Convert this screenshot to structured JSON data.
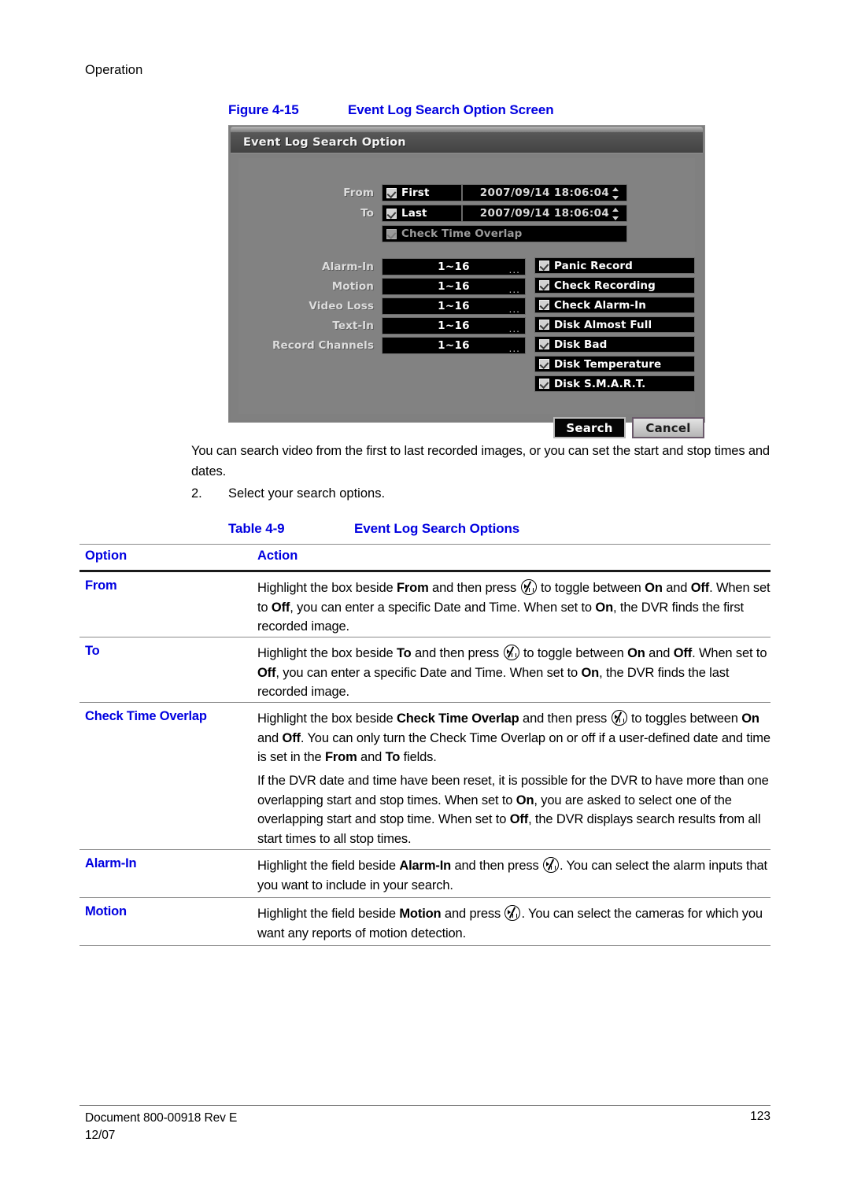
{
  "page": {
    "running_head": "Operation",
    "footer_document": "Document 800-00918 Rev E",
    "footer_date": "12/07",
    "footer_page_number": "123"
  },
  "figure": {
    "number": "Figure 4-15",
    "title": "Event Log Search Option Screen",
    "caption_color": "#0000e0"
  },
  "dvr_dialog": {
    "title": "Event Log Search Option",
    "colors": {
      "titlebar": "#4b4b4b",
      "body": "#808080",
      "field_background": "#000000",
      "field_text": "#ffffff"
    },
    "time_rows": [
      {
        "label": "From",
        "checkbox_label": "First",
        "checked": true,
        "enabled": true,
        "datetime": "2007/09/14  18:06:04",
        "spinner": true
      },
      {
        "label": "To",
        "checkbox_label": "Last",
        "checked": true,
        "enabled": true,
        "datetime": "2007/09/14  18:06:04",
        "spinner": true
      }
    ],
    "check_time_overlap": {
      "label": "Check Time Overlap",
      "checked": true,
      "enabled": false
    },
    "range_fields": [
      {
        "label": "Alarm-In",
        "value": "1~16",
        "more": "..."
      },
      {
        "label": "Motion",
        "value": "1~16",
        "more": "..."
      },
      {
        "label": "Video Loss",
        "value": "1~16",
        "more": "..."
      },
      {
        "label": "Text-In",
        "value": "1~16",
        "more": "..."
      },
      {
        "label": "Record Channels",
        "value": "1~16",
        "more": "..."
      }
    ],
    "event_checkboxes": [
      {
        "label": "Panic Record",
        "checked": true
      },
      {
        "label": "Check Recording",
        "checked": true
      },
      {
        "label": "Check Alarm-In",
        "checked": true
      },
      {
        "label": "Disk Almost Full",
        "checked": true
      },
      {
        "label": "Disk Bad",
        "checked": true
      },
      {
        "label": "Disk Temperature",
        "checked": true
      },
      {
        "label": "Disk S.M.A.R.T.",
        "checked": true
      }
    ],
    "buttons": {
      "search": "Search",
      "cancel": "Cancel"
    }
  },
  "body_text": {
    "intro": "You can search video from the first to last recorded images, or you can set the start and stop times and dates.",
    "step_number": "2.",
    "step_text": "Select your search options."
  },
  "table": {
    "number": "Table 4-9",
    "title": "Event Log Search Options",
    "headers": {
      "option": "Option",
      "action": "Action"
    },
    "rows": [
      {
        "option": "From",
        "action_html": "Highlight the box beside <b>From</b> and then press <span class=\"keyicon\" data-name=\"dvr-enter-key-icon\" data-interactable=\"false\"><i class=\"slash\"></i><i class=\"tri\"></i><i class=\"bars\"></i></span> to toggle between <b>On</b> and <b>Off</b>. When set to <b>Off</b>, you can enter a specific Date and Time. When set to <b>On</b>, the DVR finds the first recorded image."
      },
      {
        "option": "To",
        "action_html": "Highlight the box beside <b>To</b> and then press <span class=\"keyicon\" data-name=\"dvr-enter-key-icon\" data-interactable=\"false\"><i class=\"slash\"></i><i class=\"tri\"></i><i class=\"bars\"></i></span> to toggle between <b>On</b> and <b>Off</b>. When set to <b>Off</b>, you can enter a specific Date and Time. When set to <b>On</b>, the DVR finds the last recorded image."
      },
      {
        "option": "Check Time Overlap",
        "action_html": "Highlight the box beside <b>Check Time Overlap</b> and then press <span class=\"keyicon\" data-name=\"dvr-enter-key-icon\" data-interactable=\"false\"><i class=\"slash\"></i><i class=\"tri\"></i><i class=\"bars\"></i></span> to toggles between <b>On</b> and <b>Off</b>. You can only turn the Check Time Overlap on or off if a user-defined date and time is set in the <b>From</b> and <b>To</b> fields.",
        "action_html_2": "If the DVR date and time have been reset, it is possible for the DVR to have more than one overlapping start and stop times. When set to <b>On</b>, you are asked to select one of the overlapping start and stop time. When set to <b>Off</b>, the DVR displays search results from all start times to all stop times."
      },
      {
        "option": "Alarm-In",
        "action_html": "Highlight the field beside <b>Alarm-In</b> and then press <span class=\"keyicon\" data-name=\"dvr-enter-key-icon\" data-interactable=\"false\"><i class=\"slash\"></i><i class=\"tri\"></i><i class=\"bars\"></i></span>. You can select the alarm inputs that you want to include in your search."
      },
      {
        "option": "Motion",
        "action_html": "Highlight the field beside <b>Motion</b> and press <span class=\"keyicon\" data-name=\"dvr-enter-key-icon\" data-interactable=\"false\"><i class=\"slash\"></i><i class=\"tri\"></i><i class=\"bars\"></i></span>. You can select the cameras for which you want any reports of motion detection."
      }
    ]
  }
}
